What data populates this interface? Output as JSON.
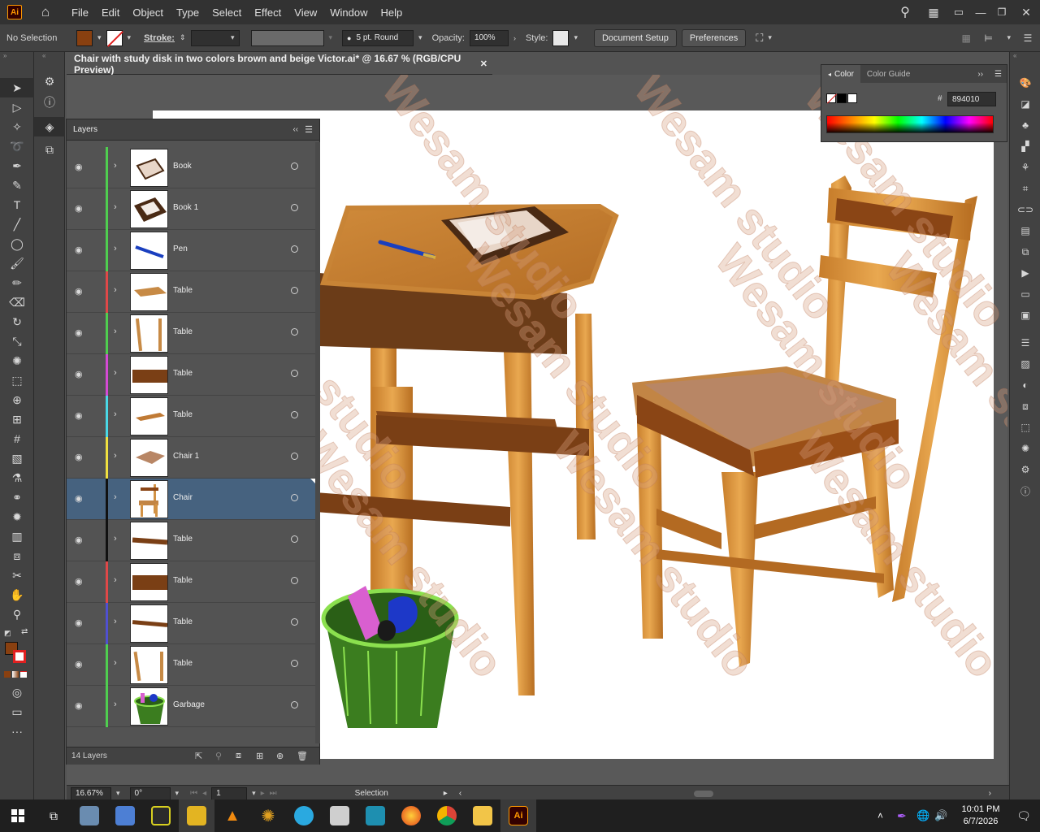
{
  "app": {
    "logo": "Ai",
    "menu": [
      "File",
      "Edit",
      "Object",
      "Type",
      "Select",
      "Effect",
      "View",
      "Window",
      "Help"
    ]
  },
  "control_bar": {
    "selection": "No Selection",
    "fill_color": "#894010",
    "stroke_label": "Stroke:",
    "brush": "5 pt. Round",
    "opacity_label": "Opacity:",
    "opacity": "100%",
    "style_label": "Style:",
    "document_setup": "Document Setup",
    "preferences": "Preferences"
  },
  "document": {
    "tab_title": "Chair with study disk in two colors brown and beige Victor.ai* @ 16.67 % (RGB/CPU Preview)"
  },
  "layers_panel": {
    "title": "Layers",
    "count": "14 Layers",
    "layers": [
      {
        "name": "Book",
        "color": "#4fce4f",
        "thumb": "book"
      },
      {
        "name": "Book 1",
        "color": "#4fce4f",
        "thumb": "book1"
      },
      {
        "name": "Pen",
        "color": "#4fce4f",
        "thumb": "pen"
      },
      {
        "name": "Table",
        "color": "#e04848",
        "thumb": "tabletop"
      },
      {
        "name": "Table",
        "color": "#4fce4f",
        "thumb": "legs"
      },
      {
        "name": "Table",
        "color": "#d44ad4",
        "thumb": "apron"
      },
      {
        "name": "Table",
        "color": "#4ad8e6",
        "thumb": "tabletop2"
      },
      {
        "name": "Chair 1",
        "color": "#f0e040",
        "thumb": "seat"
      },
      {
        "name": "Chair",
        "color": "#111111",
        "thumb": "chair",
        "selected": true
      },
      {
        "name": "Table",
        "color": "#111111",
        "thumb": "bar"
      },
      {
        "name": "Table",
        "color": "#e04848",
        "thumb": "apron2"
      },
      {
        "name": "Table",
        "color": "#5050d0",
        "thumb": "bar2"
      },
      {
        "name": "Table",
        "color": "#4fce4f",
        "thumb": "legs2"
      },
      {
        "name": "Garbage",
        "color": "#4fce4f",
        "thumb": "garbage"
      }
    ]
  },
  "color_panel": {
    "tabs": [
      "Color",
      "Color Guide"
    ],
    "hex_label": "#",
    "hex": "894010"
  },
  "status_bar": {
    "zoom": "16.67%",
    "rotation": "0°",
    "artboard": "1",
    "tool": "Selection"
  },
  "taskbar": {
    "time": "10:01 PM",
    "date": "6/7/2026"
  },
  "watermark": "Wesam studio"
}
